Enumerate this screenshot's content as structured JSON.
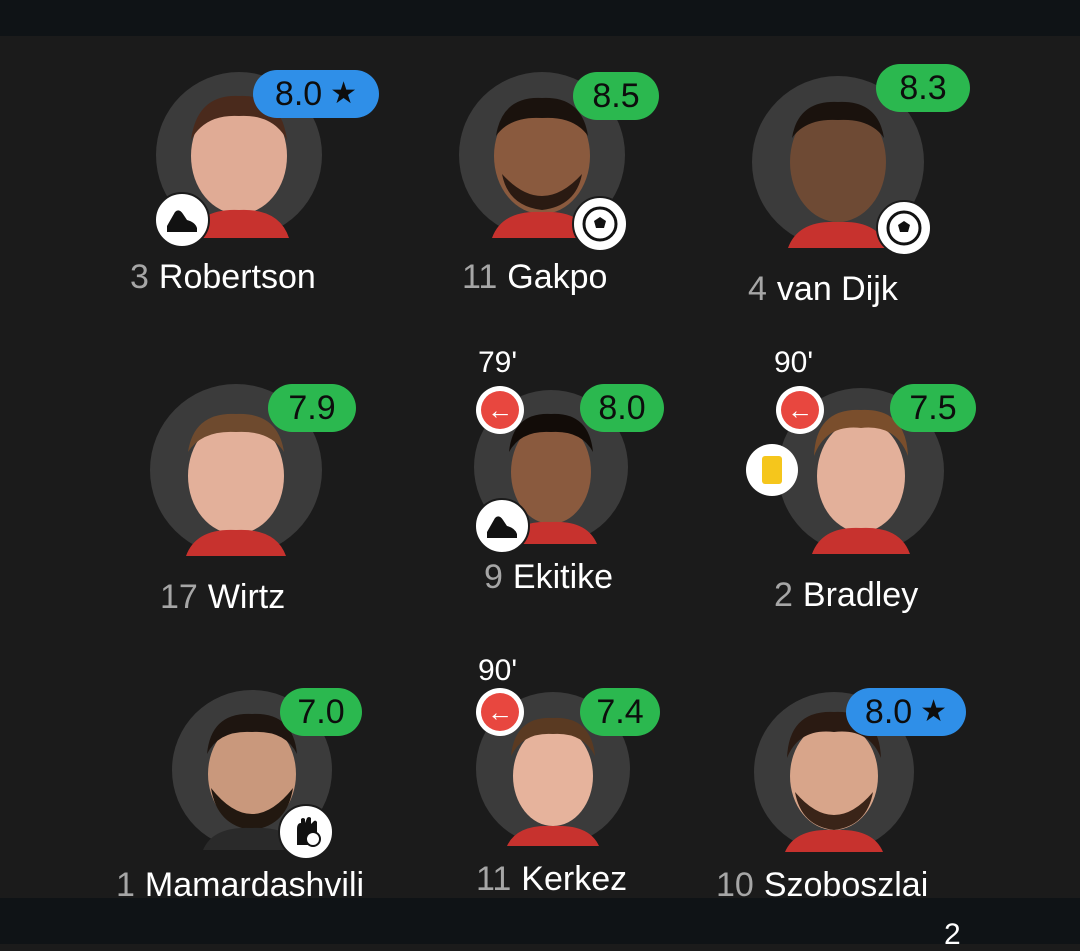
{
  "players": [
    {
      "number": "3",
      "name": "Robertson",
      "rating": "8.0",
      "rating_color": "blue",
      "top_rated": true,
      "star": "★",
      "event_icon": "boot-icon",
      "sub_minute": "",
      "yellow_card": false
    },
    {
      "number": "11",
      "name": "Gakpo",
      "rating": "8.5",
      "rating_color": "green",
      "top_rated": false,
      "star": "",
      "event_icon": "football-icon",
      "sub_minute": "",
      "yellow_card": false
    },
    {
      "number": "4",
      "name": "van Dijk",
      "rating": "8.3",
      "rating_color": "green",
      "top_rated": false,
      "star": "",
      "event_icon": "football-icon",
      "sub_minute": "",
      "yellow_card": false
    },
    {
      "number": "17",
      "name": "Wirtz",
      "rating": "7.9",
      "rating_color": "green",
      "top_rated": false,
      "star": "",
      "event_icon": "",
      "sub_minute": "",
      "yellow_card": false
    },
    {
      "number": "9",
      "name": "Ekitike",
      "rating": "8.0",
      "rating_color": "green",
      "top_rated": false,
      "star": "",
      "event_icon": "boot-icon",
      "sub_minute": "79'",
      "yellow_card": false
    },
    {
      "number": "2",
      "name": "Bradley",
      "rating": "7.5",
      "rating_color": "green",
      "top_rated": false,
      "star": "",
      "event_icon": "",
      "sub_minute": "90'",
      "yellow_card": true
    },
    {
      "number": "1",
      "name": "Mamardashvili",
      "rating": "7.0",
      "rating_color": "green",
      "top_rated": false,
      "star": "",
      "event_icon": "goalkeeper-glove-icon",
      "sub_minute": "",
      "yellow_card": false
    },
    {
      "number": "11",
      "name": "Kerkez",
      "rating": "7.4",
      "rating_color": "green",
      "top_rated": false,
      "star": "",
      "event_icon": "",
      "sub_minute": "90'",
      "yellow_card": false
    },
    {
      "number": "10",
      "name": "Szoboszlai",
      "rating": "8.0",
      "rating_color": "blue",
      "top_rated": true,
      "star": "★",
      "event_icon": "",
      "sub_minute": "",
      "yellow_card": false
    }
  ],
  "sub_arrow": "←",
  "page_indicator": "2",
  "colors": {
    "green": "#2bb84f",
    "blue": "#2f8fe8",
    "sub_red": "#e8473f",
    "yellow_card": "#f5c61c",
    "background": "#1b1b1b"
  }
}
